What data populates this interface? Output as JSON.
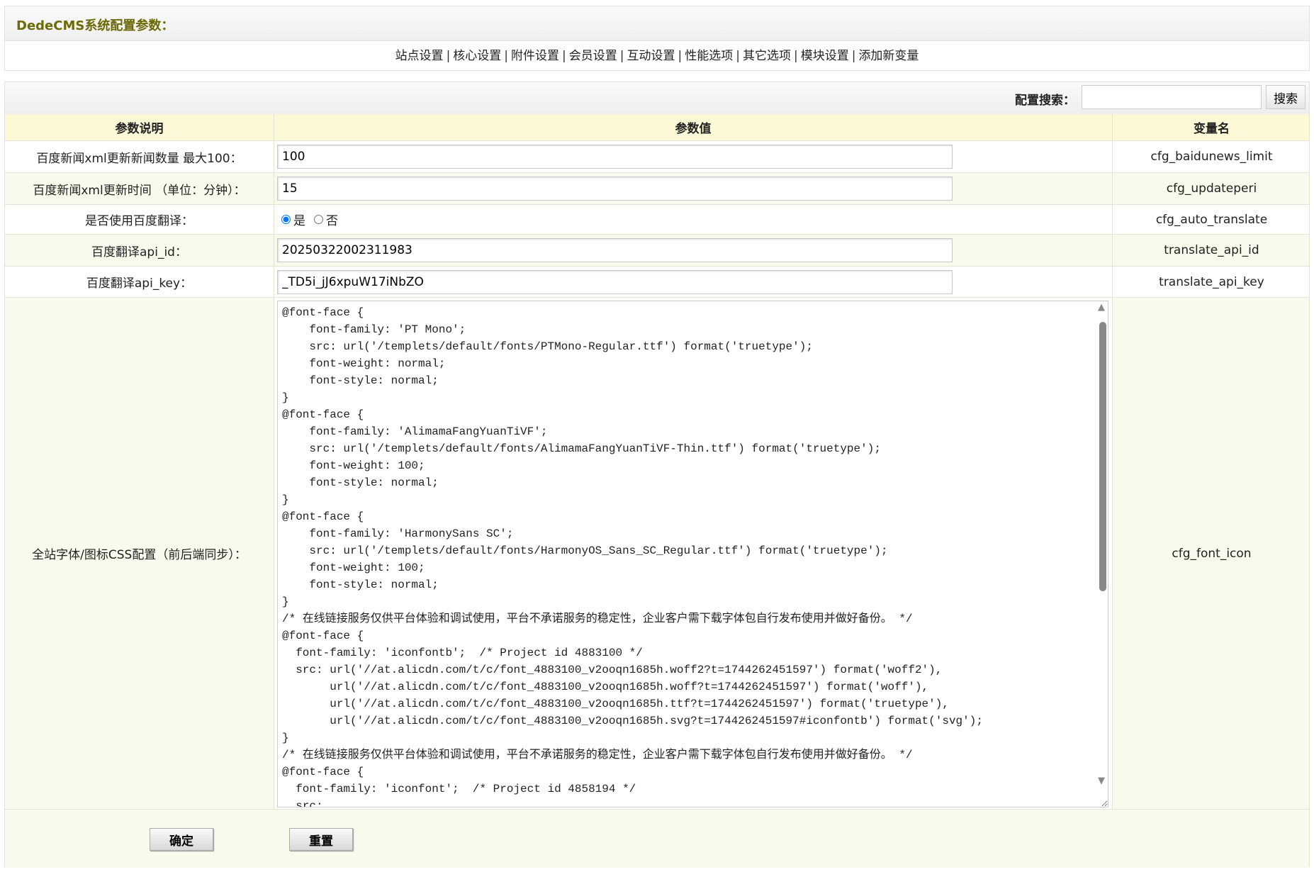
{
  "title": "DedeCMS系统配置参数：",
  "nav": [
    "站点设置",
    "核心设置",
    "附件设置",
    "会员设置",
    "互动设置",
    "性能选项",
    "其它选项",
    "模块设置",
    "添加新变量"
  ],
  "search": {
    "label": "配置搜索：",
    "value": "",
    "button": "搜索"
  },
  "table": {
    "headers": [
      "参数说明",
      "参数值",
      "变量名"
    ],
    "rows": [
      {
        "label": "百度新闻xml更新新闻数量 最大100：",
        "value": "100",
        "var": "cfg_baidunews_limit"
      },
      {
        "label": "百度新闻xml更新时间 （单位：分钟）：",
        "value": "15",
        "var": "cfg_updateperi"
      },
      {
        "label": "是否使用百度翻译：",
        "options": [
          "是",
          "否"
        ],
        "selected": "是",
        "var": "cfg_auto_translate"
      },
      {
        "label": "百度翻译api_id：",
        "value": "20250322002311983",
        "var": "translate_api_id"
      },
      {
        "label": "百度翻译api_key：",
        "value": "_TD5i_jJ6xpuW17iNbZO",
        "var": "translate_api_key"
      },
      {
        "label": "全站字体/图标CSS配置（前后端同步）：",
        "value": "@font-face {\n    font-family: 'PT Mono';\n    src: url('/templets/default/fonts/PTMono-Regular.ttf') format('truetype');\n    font-weight: normal;\n    font-style: normal;\n}\n@font-face {\n    font-family: 'AlimamaFangYuanTiVF';\n    src: url('/templets/default/fonts/AlimamaFangYuanTiVF-Thin.ttf') format('truetype');\n    font-weight: 100;\n    font-style: normal;\n}\n@font-face {\n    font-family: 'HarmonySans SC';\n    src: url('/templets/default/fonts/HarmonyOS_Sans_SC_Regular.ttf') format('truetype');\n    font-weight: 100;\n    font-style: normal;\n}\n/* 在线链接服务仅供平台体验和调试使用，平台不承诺服务的稳定性，企业客户需下载字体包自行发布使用并做好备份。 */\n@font-face {\n  font-family: 'iconfontb';  /* Project id 4883100 */\n  src: url('//at.alicdn.com/t/c/font_4883100_v2ooqn1685h.woff2?t=1744262451597') format('woff2'),\n       url('//at.alicdn.com/t/c/font_4883100_v2ooqn1685h.woff?t=1744262451597') format('woff'),\n       url('//at.alicdn.com/t/c/font_4883100_v2ooqn1685h.ttf?t=1744262451597') format('truetype'),\n       url('//at.alicdn.com/t/c/font_4883100_v2ooqn1685h.svg?t=1744262451597#iconfontb') format('svg');\n}\n/* 在线链接服务仅供平台体验和调试使用，平台不承诺服务的稳定性，企业客户需下载字体包自行发布使用并做好备份。 */\n@font-face {\n  font-family: 'iconfont';  /* Project id 4858194 */\n  src:",
        "var": "cfg_font_icon"
      }
    ]
  },
  "buttons": {
    "ok": "确定",
    "reset": "重置"
  }
}
